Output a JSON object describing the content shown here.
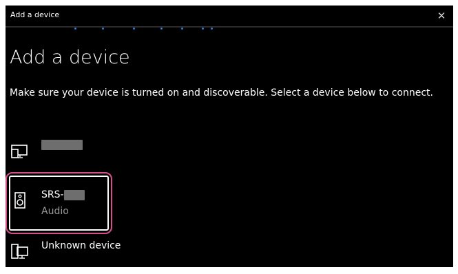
{
  "window": {
    "title": "Add a device",
    "close_glyph": "✕"
  },
  "heading": "Add a device",
  "description": "Make sure your device is turned on and discoverable. Select a device below to connect.",
  "devices": [
    {
      "name": "",
      "type": "",
      "icon": "display-icon",
      "redacted": true
    },
    {
      "name": "SRS-",
      "type": "Audio",
      "icon": "speaker-icon",
      "redacted": true,
      "selected": true
    },
    {
      "name": "Unknown device",
      "type": "",
      "icon": "computer-icon",
      "redacted": false
    }
  ],
  "colors": {
    "background": "#000000",
    "accent": "#2b78d4",
    "highlight": "#d64f8c"
  }
}
